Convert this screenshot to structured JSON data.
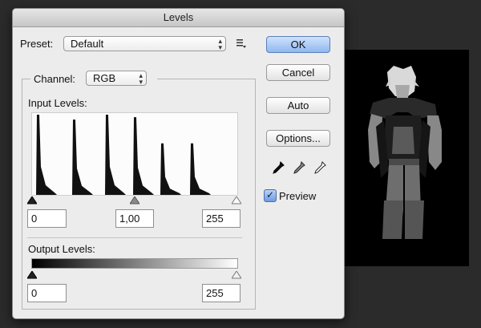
{
  "dialog": {
    "title": "Levels",
    "preset_label": "Preset:",
    "preset_value": "Default",
    "channel_label": "Channel:",
    "channel_value": "RGB",
    "input_levels_label": "Input Levels:",
    "output_levels_label": "Output Levels:",
    "input_black": "0",
    "input_gamma": "1,00",
    "input_white": "255",
    "output_black": "0",
    "output_white": "255"
  },
  "buttons": {
    "ok": "OK",
    "cancel": "Cancel",
    "auto": "Auto",
    "options": "Options..."
  },
  "preview": {
    "label": "Preview",
    "checked": true
  },
  "icons": {
    "preset_menu": "preset-options-icon",
    "eyedroppers": [
      "black-point-eyedropper-icon",
      "gray-point-eyedropper-icon",
      "white-point-eyedropper-icon"
    ]
  },
  "histogram": {
    "peaks": [
      {
        "level": 7,
        "height": 0.98
      },
      {
        "level": 52,
        "height": 0.92
      },
      {
        "level": 93,
        "height": 0.98
      },
      {
        "level": 128,
        "height": 0.95
      },
      {
        "level": 162,
        "height": 0.63
      },
      {
        "level": 199,
        "height": 0.63
      }
    ]
  },
  "colors": {
    "default_button": "#8fb8ef",
    "dialog_bg": "#ececec",
    "histogram_fill": "#111111"
  }
}
